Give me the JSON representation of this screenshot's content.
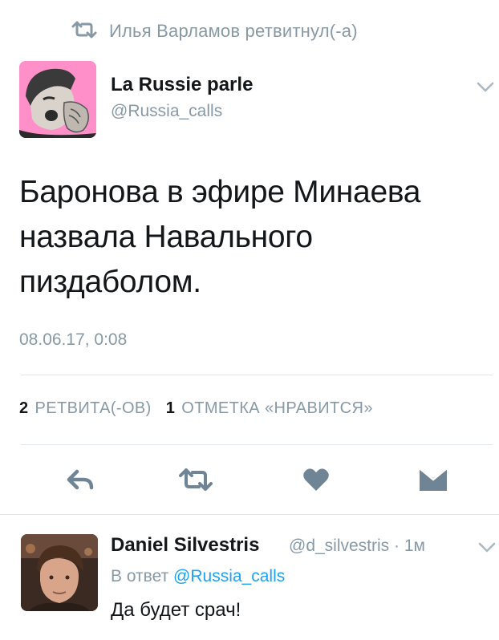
{
  "retweet_header": {
    "icon": "retweet-icon",
    "text": "Илья Варламов ретвитнул(-а)"
  },
  "tweet": {
    "author_name": "La Russie parle",
    "author_handle": "@Russia_calls",
    "text_lines": [
      "Баронова в эфире Минаева",
      "назвала Навального",
      "пиздаболом."
    ],
    "timestamp": "08.06.17, 0:08",
    "stats": {
      "retweets_count": "2",
      "retweets_label": "РЕТВИТА(-ОВ)",
      "likes_count": "1",
      "likes_label": "ОТМЕТКА «НРАВИТСЯ»"
    },
    "actions": [
      "reply-icon",
      "retweet-icon",
      "heart-icon",
      "envelope-icon"
    ]
  },
  "reply": {
    "author_name": "Daniel Silvestris",
    "author_handle": "@d_silvestris",
    "separator": " · ",
    "age": "1м",
    "in_reply_prefix": "В ответ",
    "in_reply_handle": "@Russia_calls",
    "text": "Да будет срач!"
  },
  "colors": {
    "text": "#14171a",
    "muted": "#8899a6",
    "link": "#1da1f2",
    "icon": "#6f8596",
    "divider": "#dfe5ea",
    "avatar_bg": "#ff8fc8"
  }
}
